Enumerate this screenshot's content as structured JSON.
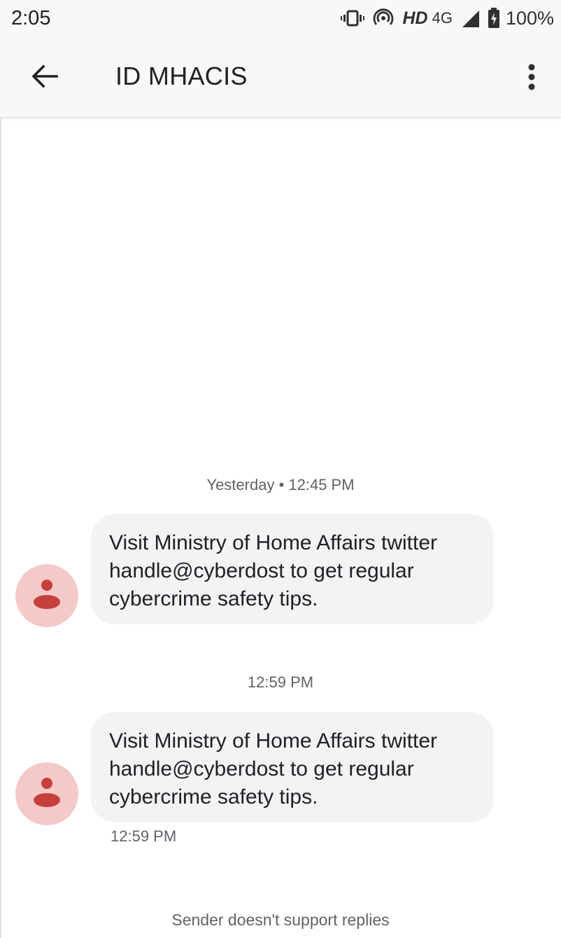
{
  "status_bar": {
    "time": "2:05",
    "network_hd": "HD",
    "network_type": "4G",
    "battery": "100%",
    "icons": [
      "vibrate-icon",
      "hotspot-icon",
      "signal-icon",
      "battery-charging-icon"
    ]
  },
  "app_bar": {
    "back_icon": "arrow-back-icon",
    "title": "ID MHACIS",
    "menu_icon": "more-vert-icon"
  },
  "conversation": {
    "messages": [
      {
        "separator": "Yesterday • 12:45 PM",
        "text": "Visit Ministry of Home Affairs twitter handle@cyberdost to get regular cybercrime safety tips.",
        "avatar_icon": "person-icon"
      },
      {
        "separator": "12:59 PM",
        "text": "Visit Ministry of Home Affairs twitter handle@cyberdost to get regular cybercrime safety tips.",
        "avatar_icon": "person-icon",
        "time": "12:59 PM"
      }
    ]
  },
  "footer": {
    "note": "Sender doesn't support replies"
  },
  "colors": {
    "app_bar_bg": "#f8f8f8",
    "bubble_bg": "#f1f3f4",
    "avatar_bg": "#f6c9c9",
    "avatar_fg": "#c5403c",
    "secondary_text": "#5f6368"
  }
}
